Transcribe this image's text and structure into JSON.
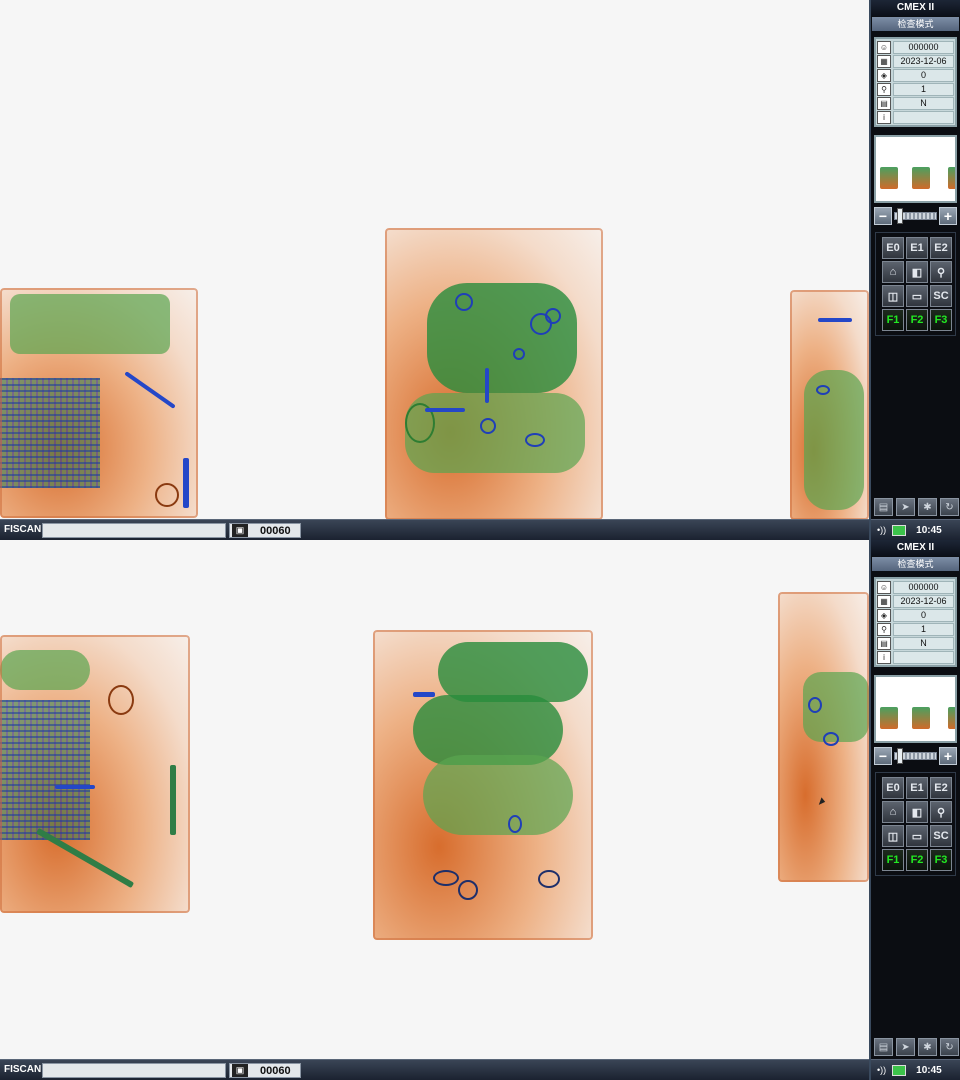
{
  "app": {
    "brand": "FISCAN",
    "system_title": "CMEX II",
    "mode_label": "检查模式",
    "bag_count": "00060",
    "clock": "10:45",
    "signal_icon": "speaker-signal-icon",
    "network_icon": "network-monitor-icon"
  },
  "info_panel": [
    {
      "icon": "operator-icon",
      "value": "000000"
    },
    {
      "icon": "calendar-icon",
      "value": "2023-12-06"
    },
    {
      "icon": "counter-icon",
      "value": "0"
    },
    {
      "icon": "magnifier-icon",
      "value": "1"
    },
    {
      "icon": "alarm-icon",
      "value": "N"
    },
    {
      "icon": "info-icon",
      "value": ""
    }
  ],
  "function_buttons": [
    {
      "label": "E0"
    },
    {
      "label": "E1"
    },
    {
      "label": "E2"
    },
    {
      "label": "⌂",
      "icon": "home-icon"
    },
    {
      "label": "◧",
      "icon": "half-display-icon"
    },
    {
      "label": "⚲",
      "icon": "zoom-icon"
    },
    {
      "label": "◫",
      "icon": "split-view-icon"
    },
    {
      "label": "▭",
      "icon": "keyboard-icon"
    },
    {
      "label": "SC"
    },
    {
      "label": "F1"
    },
    {
      "label": "F2"
    },
    {
      "label": "F3"
    }
  ],
  "zoom": {
    "minus": "−",
    "plus": "+"
  },
  "colors": {
    "organic": "#d2550a",
    "inorganic": "#288c3c",
    "metal": "#1f3fb8",
    "accent_green": "#22e822"
  }
}
